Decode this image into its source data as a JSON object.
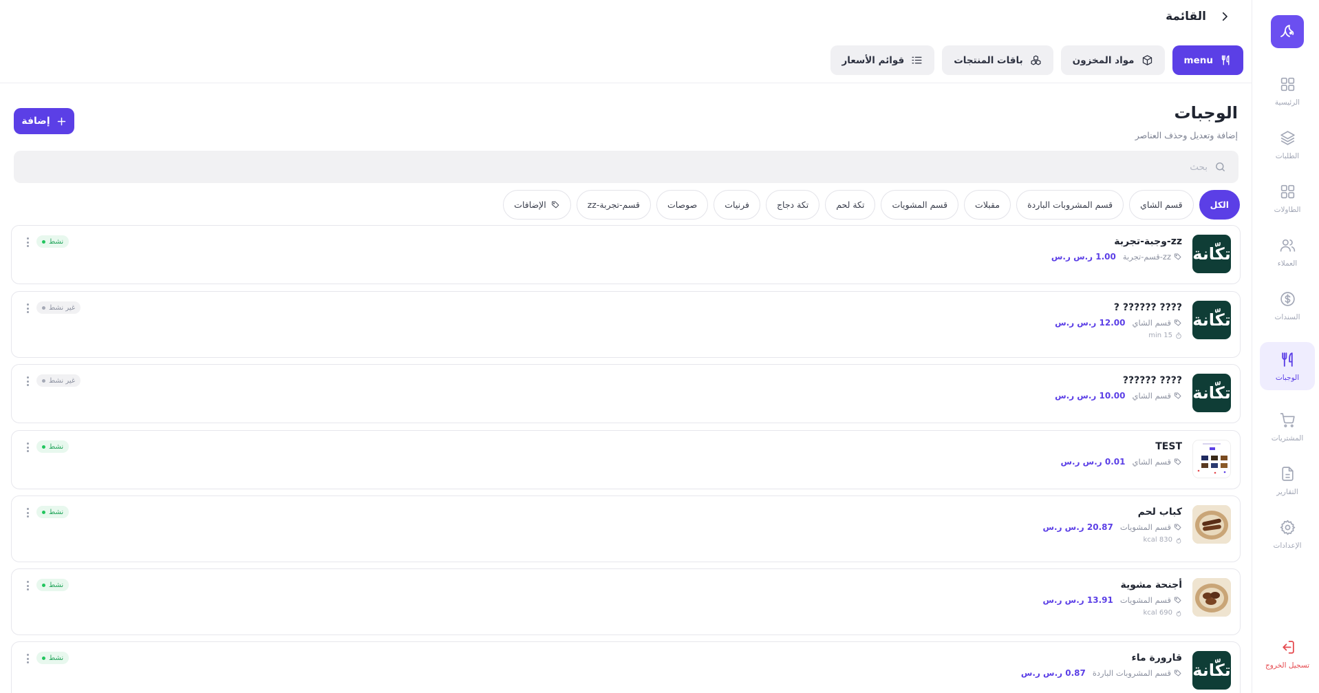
{
  "header": {
    "title": "القائمة"
  },
  "tabs": [
    {
      "label": "menu",
      "icon": "utensils-icon",
      "active": true
    },
    {
      "label": "مواد المخزون",
      "icon": "box-icon",
      "active": false
    },
    {
      "label": "باقات المنتجات",
      "icon": "bundle-icon",
      "active": false
    },
    {
      "label": "قوائم الأسعار",
      "icon": "list-icon",
      "active": false
    }
  ],
  "page": {
    "title": "الوجبات",
    "subtitle": "إضافة وتعديل وحذف العناصر",
    "add_label": "إضافة"
  },
  "search": {
    "placeholder": "بحث"
  },
  "filters": [
    "الكل",
    "قسم الشاي",
    "قسم المشروبات الباردة",
    "مقبلات",
    "قسم المشويات",
    "تكة لحم",
    "تكة دجاج",
    "فرنيات",
    "صوصات",
    "zz-قسم-تجربة",
    "الإضافات"
  ],
  "sidebar": {
    "items": [
      {
        "label": "الرئيسية",
        "icon": "grid-icon"
      },
      {
        "label": "الطلبات",
        "icon": "layers-icon"
      },
      {
        "label": "الطاولات",
        "icon": "tables-icon"
      },
      {
        "label": "العملاء",
        "icon": "users-icon"
      },
      {
        "label": "السندات",
        "icon": "dollar-icon"
      },
      {
        "label": "الوجبات",
        "icon": "utensils-icon",
        "active": true
      },
      {
        "label": "المشتريات",
        "icon": "cart-icon"
      },
      {
        "label": "التقارير",
        "icon": "file-icon"
      },
      {
        "label": "الإعدادات",
        "icon": "gear-icon"
      }
    ],
    "logout": "تسجيل الخروج"
  },
  "items": [
    {
      "name": "zz-وجبة-تجربة",
      "category": "zz-قسم-تجربة",
      "price": "1.00 ر.س ر.س",
      "extra": "",
      "status": "نشط",
      "active": true,
      "thumb": "brand"
    },
    {
      "name": "???? ?????? ?",
      "category": "قسم الشاي",
      "price": "12.00 ر.س ر.س",
      "extra": "15 min",
      "status": "غير نشط",
      "active": false,
      "thumb": "brand"
    },
    {
      "name": "???? ??????",
      "category": "قسم الشاي",
      "price": "10.00 ر.س ر.س",
      "extra": "",
      "status": "غير نشط",
      "active": false,
      "thumb": "brand"
    },
    {
      "name": "TEST",
      "category": "قسم الشاي",
      "price": "0.01 ر.س ر.س",
      "extra": "",
      "status": "نشط",
      "active": true,
      "thumb": "shot"
    },
    {
      "name": "كباب لحم",
      "category": "قسم المشويات",
      "price": "20.87 ر.س ر.س",
      "extra": "830 kcal",
      "status": "نشط",
      "active": true,
      "thumb": "food"
    },
    {
      "name": "أجنحة مشوية",
      "category": "قسم المشويات",
      "price": "13.91 ر.س ر.س",
      "extra": "690 kcal",
      "status": "نشط",
      "active": true,
      "thumb": "food"
    },
    {
      "name": "قارورة ماء",
      "category": "قسم المشروبات الباردة",
      "price": "0.87 ر.س ر.س",
      "extra": "",
      "status": "نشط",
      "active": true,
      "thumb": "brand"
    }
  ],
  "brand_mark": "تكّانة"
}
